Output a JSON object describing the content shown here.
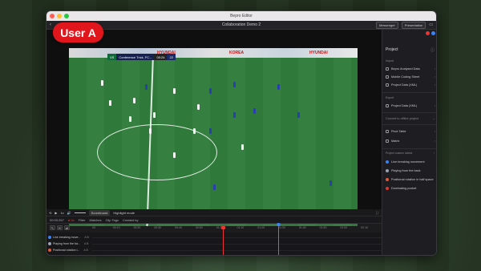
{
  "window": {
    "title": "Bepro Editor",
    "doc_title": "Collaboration Demo 2",
    "buttons": {
      "messenger": "Messenger",
      "presentation": "Presentation"
    }
  },
  "overlay": {
    "user_badge": "User A"
  },
  "scorebug": {
    "team_a": "VS",
    "match": "Conference Trick, FC...",
    "score": "00:24",
    "extra": "22"
  },
  "ads": {
    "left": "HYUNDAI",
    "mid": "KOREA",
    "right": "HYUNDAI"
  },
  "controls": {
    "speed": "1x",
    "scoreboard": "Scoreboard",
    "highlight": "Highlight mode"
  },
  "timeline": {
    "time": "00:00:267",
    "rec": "● 2s",
    "filter": "Filter",
    "matches": "Matches",
    "clip_tags": "Clip Tags",
    "created_by": "Created by"
  },
  "ruler": [
    "00",
    "00:10",
    "00:20",
    "00:30",
    "00:40",
    "00:50",
    "01:00",
    "01:10",
    "01:20",
    "01:30",
    "01:40",
    "01:50",
    "02:00",
    "02:10"
  ],
  "tracks": [
    {
      "label": "Line breaking move...",
      "color": "#3b82f6"
    },
    {
      "label": "Playing from the ba...",
      "color": "#9aa3b5"
    },
    {
      "label": "Positional rotation i...",
      "color": "#e05a3a"
    },
    {
      "label": "Dominating pocket",
      "color": "#e0342f"
    }
  ],
  "right_panel": {
    "project": "Project",
    "import": "Import",
    "import_items": [
      "Bepro Analysed Data",
      "Mobile Coding Sheet",
      "Project Data (XML)"
    ],
    "export": "Export",
    "export_items": [
      "Project Data (XML)"
    ],
    "convert": "Convert to offline project",
    "tools": [
      "Pivot Table",
      "Matrix"
    ],
    "custom_labels": "Project custom labels",
    "labels": [
      {
        "name": "Line breaking movement",
        "color": "#3b82f6"
      },
      {
        "name": "Playing from the back",
        "color": "#9aa3b5"
      },
      {
        "name": "Positional rotation in half space",
        "color": "#e05a3a"
      },
      {
        "name": "Dominating pocket",
        "color": "#e0342f"
      }
    ]
  }
}
